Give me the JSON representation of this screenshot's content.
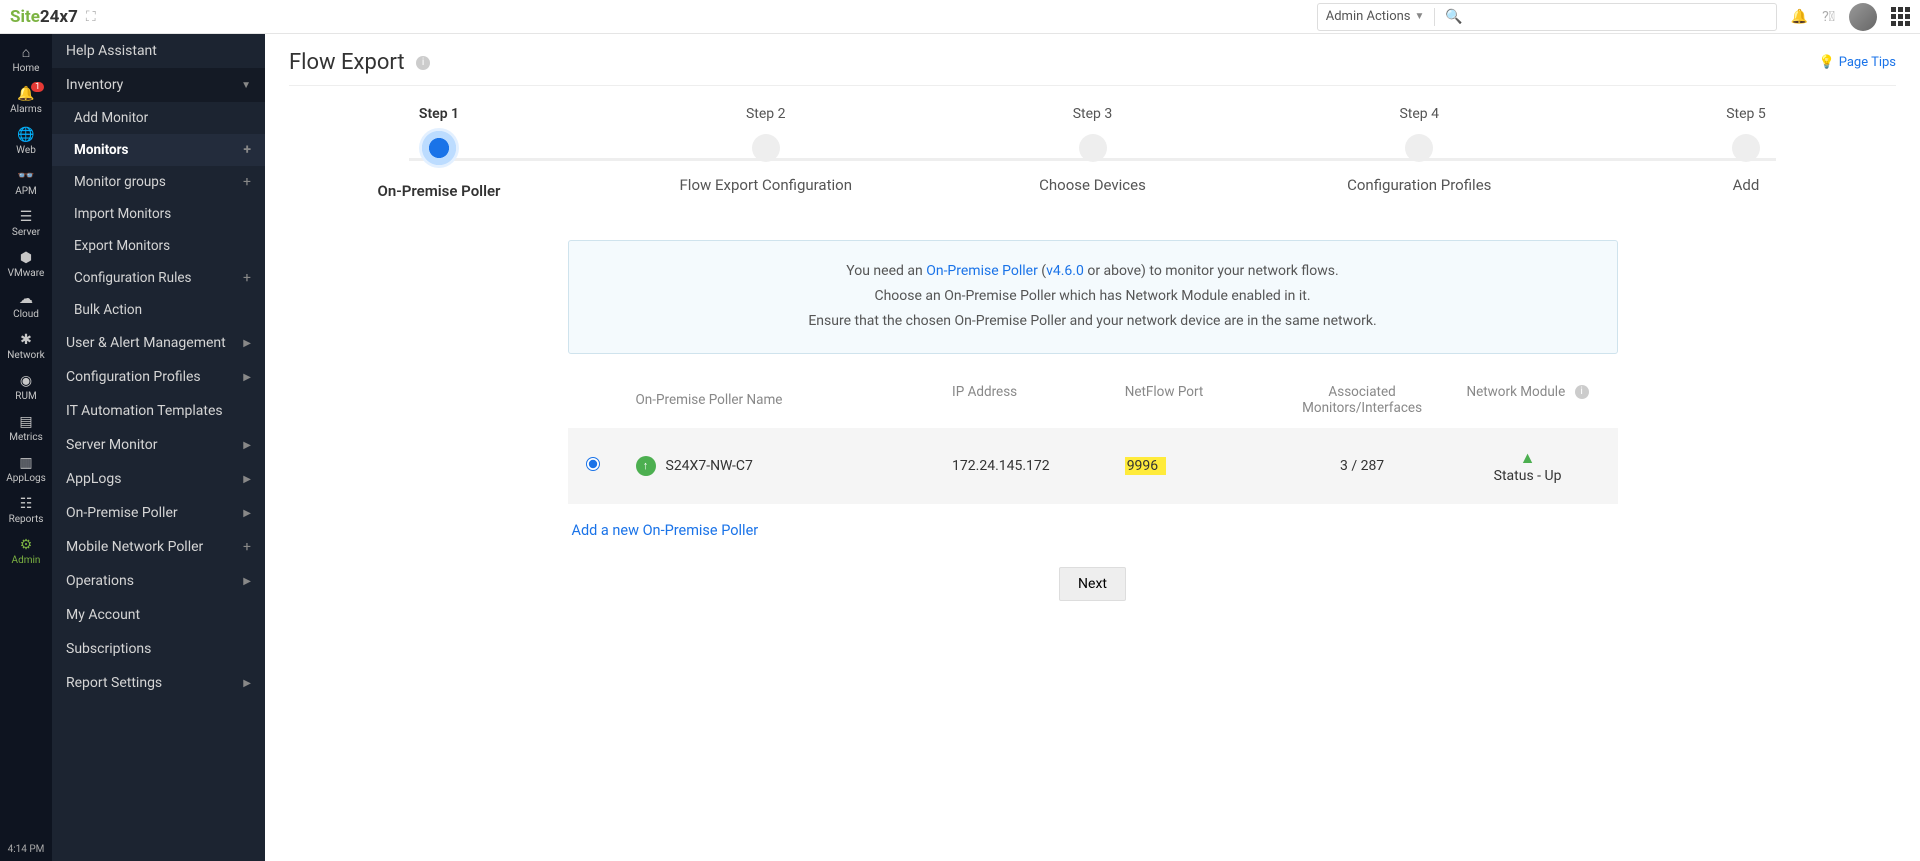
{
  "header": {
    "logo_a": "Site",
    "logo_b": "24x7",
    "admin_actions": "Admin Actions",
    "search_placeholder": ""
  },
  "rail": {
    "items": [
      {
        "label": "Home",
        "icon": "⌂"
      },
      {
        "label": "Alarms",
        "icon": "🔔",
        "badge": "1"
      },
      {
        "label": "Web",
        "icon": "🌐"
      },
      {
        "label": "APM",
        "icon": "👓"
      },
      {
        "label": "Server",
        "icon": "☰"
      },
      {
        "label": "VMware",
        "icon": "⬢"
      },
      {
        "label": "Cloud",
        "icon": "☁"
      },
      {
        "label": "Network",
        "icon": "✱"
      },
      {
        "label": "RUM",
        "icon": "◉"
      },
      {
        "label": "Metrics",
        "icon": "▤"
      },
      {
        "label": "AppLogs",
        "icon": "▥"
      },
      {
        "label": "Reports",
        "icon": "☷"
      },
      {
        "label": "Admin",
        "icon": "⚙",
        "active": true
      }
    ],
    "time": "4:14 PM"
  },
  "sidebar": {
    "help_assistant": "Help Assistant",
    "inventory": "Inventory",
    "inventory_items": [
      {
        "label": "Add Monitor"
      },
      {
        "label": "Monitors",
        "bold": true,
        "plus": true
      },
      {
        "label": "Monitor groups",
        "plus": true
      },
      {
        "label": "Import Monitors"
      },
      {
        "label": "Export Monitors"
      },
      {
        "label": "Configuration Rules",
        "plus": true
      },
      {
        "label": "Bulk Action"
      }
    ],
    "bottom_items": [
      {
        "label": "User & Alert Management",
        "chev": true
      },
      {
        "label": "Configuration Profiles",
        "chev": true
      },
      {
        "label": "IT Automation Templates"
      },
      {
        "label": "Server Monitor",
        "chev": true
      },
      {
        "label": "AppLogs",
        "chev": true
      },
      {
        "label": "On-Premise Poller",
        "chev": true
      },
      {
        "label": "Mobile Network Poller",
        "plus": true
      },
      {
        "label": "Operations",
        "chev": true
      },
      {
        "label": "My Account"
      },
      {
        "label": "Subscriptions"
      },
      {
        "label": "Report Settings",
        "chev": true
      }
    ]
  },
  "page": {
    "title": "Flow Export",
    "page_tips": "Page Tips",
    "steps": [
      {
        "step": "Step 1",
        "name": "On-Premise Poller",
        "active": true
      },
      {
        "step": "Step 2",
        "name": "Flow Export Configuration"
      },
      {
        "step": "Step 3",
        "name": "Choose Devices"
      },
      {
        "step": "Step 4",
        "name": "Configuration Profiles"
      },
      {
        "step": "Step 5",
        "name": "Add"
      }
    ],
    "banner": {
      "line1_a": "You need an ",
      "line1_link": "On-Premise Poller",
      "line1_b": " (",
      "line1_ver": "v4.6.0",
      "line1_c": " or above) to monitor your network flows.",
      "line2": "Choose an On-Premise Poller which has Network Module enabled in it.",
      "line3": "Ensure that the chosen On-Premise Poller and your network device are in the same network."
    },
    "table": {
      "headers": {
        "name": "On-Premise Poller Name",
        "ip": "IP Address",
        "port": "NetFlow Port",
        "assoc": "Associated Monitors/Interfaces",
        "net": "Network Module"
      },
      "row": {
        "name": "S24X7-NW-C7",
        "ip": "172.24.145.172",
        "port": "9996",
        "assoc": "3 / 287",
        "status": "Status - Up"
      }
    },
    "add_link": "Add a new On-Premise Poller",
    "next": "Next"
  }
}
